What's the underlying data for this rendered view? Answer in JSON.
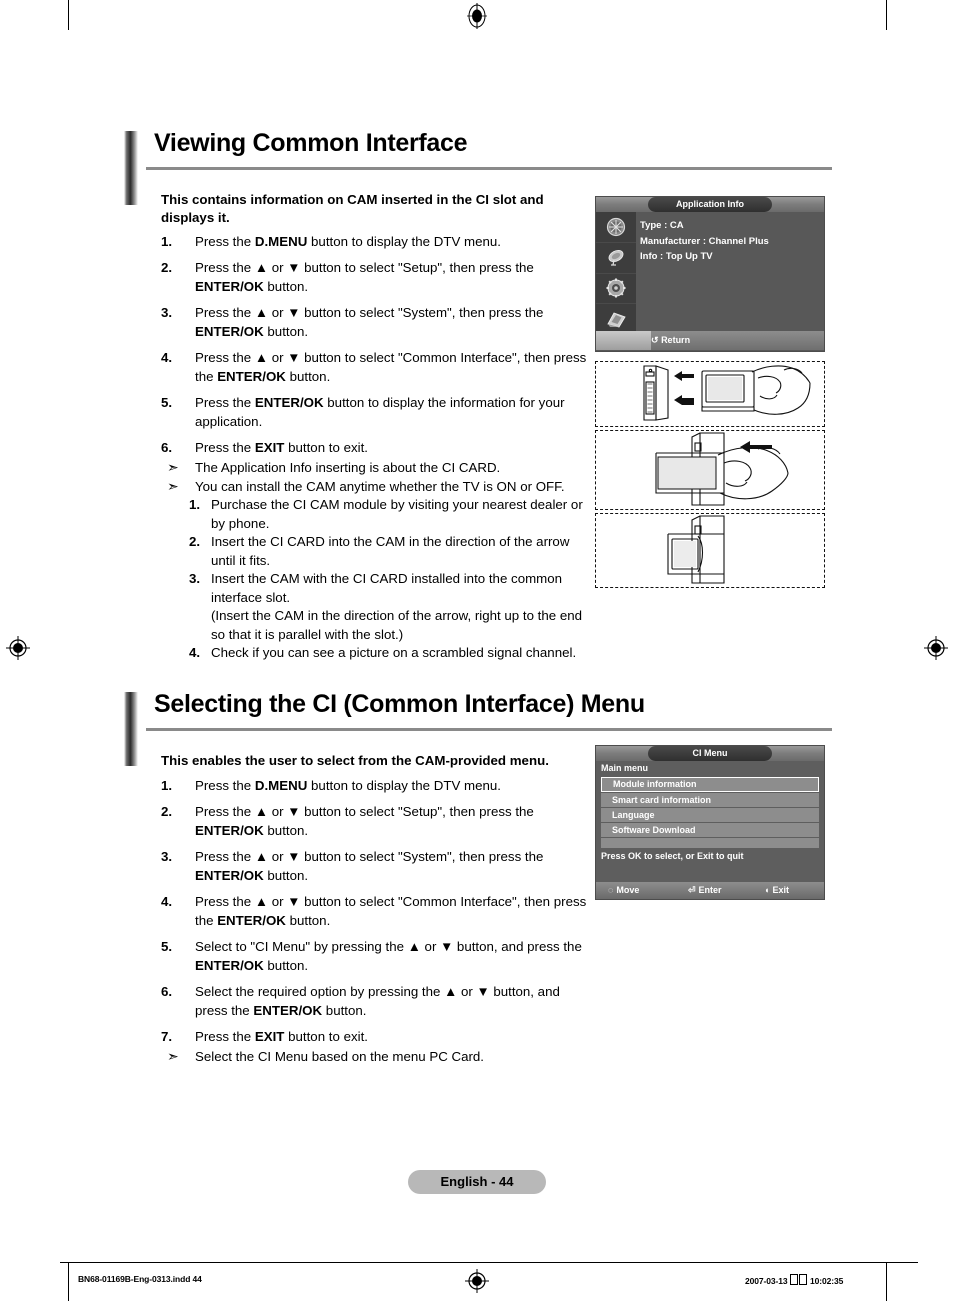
{
  "page": {
    "footer_label": "English - 44",
    "footer_file": "BN68-01169B-Eng-0313.indd   44",
    "footer_date": "2007-03-13",
    "footer_time": "10:02:35"
  },
  "section1": {
    "title": "Viewing Common Interface",
    "intro": "This contains information on CAM inserted in the CI slot and displays it.",
    "steps": [
      {
        "num": "1.",
        "html": "Press the <b>D.MENU</b> button to display the DTV menu."
      },
      {
        "num": "2.",
        "html": "Press the ▲ or ▼ button to select \"Setup\", then press the <b>ENTER/OK</b> button."
      },
      {
        "num": "3.",
        "html": "Press the ▲ or ▼ button to select \"System\", then press the <b>ENTER/OK</b> button."
      },
      {
        "num": "4.",
        "html": "Press the ▲ or ▼ button to select \"Common Interface\", then press the <b>ENTER/OK</b> button."
      },
      {
        "num": "5.",
        "html": "Press the <b>ENTER/OK</b> button to display the information for your application."
      },
      {
        "num": "6.",
        "html": "Press the <b>EXIT</b> button to exit."
      }
    ],
    "notes": [
      {
        "bullet": "➣",
        "text": "The Application Info inserting is about the CI CARD."
      },
      {
        "bullet": "➣",
        "text": "You can install the CAM anytime whether the TV is ON or OFF."
      }
    ],
    "sublist": [
      {
        "num": "1.",
        "text": "Purchase the CI CAM module by visiting your nearest dealer or by phone."
      },
      {
        "num": "2.",
        "text": "Insert the CI CARD into the CAM in the direction of the arrow until it fits."
      },
      {
        "num": "3.",
        "text": "Insert the CAM with the CI CARD installed into the common interface slot."
      },
      {
        "num": "4.",
        "text": "Check if you can see a picture on a scrambled signal channel."
      }
    ],
    "sub3_continuation": "(Insert the CAM in the direction of the arrow, right up to the end so that it is parallel with the slot.)"
  },
  "osd_appinfo": {
    "title": "Application Info",
    "lines": [
      "Type : CA",
      "Manufacturer : Channel Plus",
      "Info : Top Up TV"
    ],
    "return_label": "Return",
    "return_icon": "return-arrow-icon",
    "sidebar_icons": [
      "antenna-icon",
      "satellite-dish-icon",
      "gear-setup-icon",
      "remote-input-icon"
    ]
  },
  "section2": {
    "title": "Selecting the CI (Common Interface) Menu",
    "intro": "This enables the user to select from the CAM-provided menu.",
    "steps": [
      {
        "num": "1.",
        "html": "Press the <b>D.MENU</b> button to display the DTV menu."
      },
      {
        "num": "2.",
        "html": "Press the ▲ or ▼ button to select \"Setup\", then press the <b>ENTER/OK</b> button."
      },
      {
        "num": "3.",
        "html": "Press the ▲ or ▼ button to select \"System\", then press the <b>ENTER/OK</b> button."
      },
      {
        "num": "4.",
        "html": "Press the ▲ or ▼ button to select \"Common Interface\", then press the <b>ENTER/OK</b> button."
      },
      {
        "num": "5.",
        "html": "Select to \"CI Menu\" by pressing the ▲ or ▼ button, and press the <b>ENTER/OK</b> button."
      },
      {
        "num": "6.",
        "html": "Select the required option by pressing the ▲ or ▼ button, and press the <b>ENTER/OK</b> button."
      },
      {
        "num": "7.",
        "html": "Press the <b>EXIT</b> button to exit."
      }
    ],
    "notes": [
      {
        "bullet": "➣",
        "text": "Select the CI Menu based on the menu PC Card."
      }
    ]
  },
  "osd_cimenu": {
    "title": "CI Menu",
    "main_menu_label": "Main menu",
    "items": [
      {
        "label": "Module information",
        "selected": true
      },
      {
        "label": "Smart card information",
        "selected": false
      },
      {
        "label": "Language",
        "selected": false
      },
      {
        "label": "Software Download",
        "selected": false
      },
      {
        "label": "",
        "selected": false
      }
    ],
    "hint": "Press OK to select, or Exit to quit",
    "footer": [
      {
        "icon": "move-dpad-icon",
        "label": "Move"
      },
      {
        "icon": "enter-icon",
        "label": "Enter"
      },
      {
        "icon": "exit-icon",
        "label": "Exit"
      }
    ]
  },
  "illustrations": [
    {
      "name": "insert-ci-card-into-cam",
      "caption": ""
    },
    {
      "name": "insert-cam-into-slot",
      "caption": ""
    },
    {
      "name": "cam-fully-inserted",
      "caption": ""
    }
  ]
}
